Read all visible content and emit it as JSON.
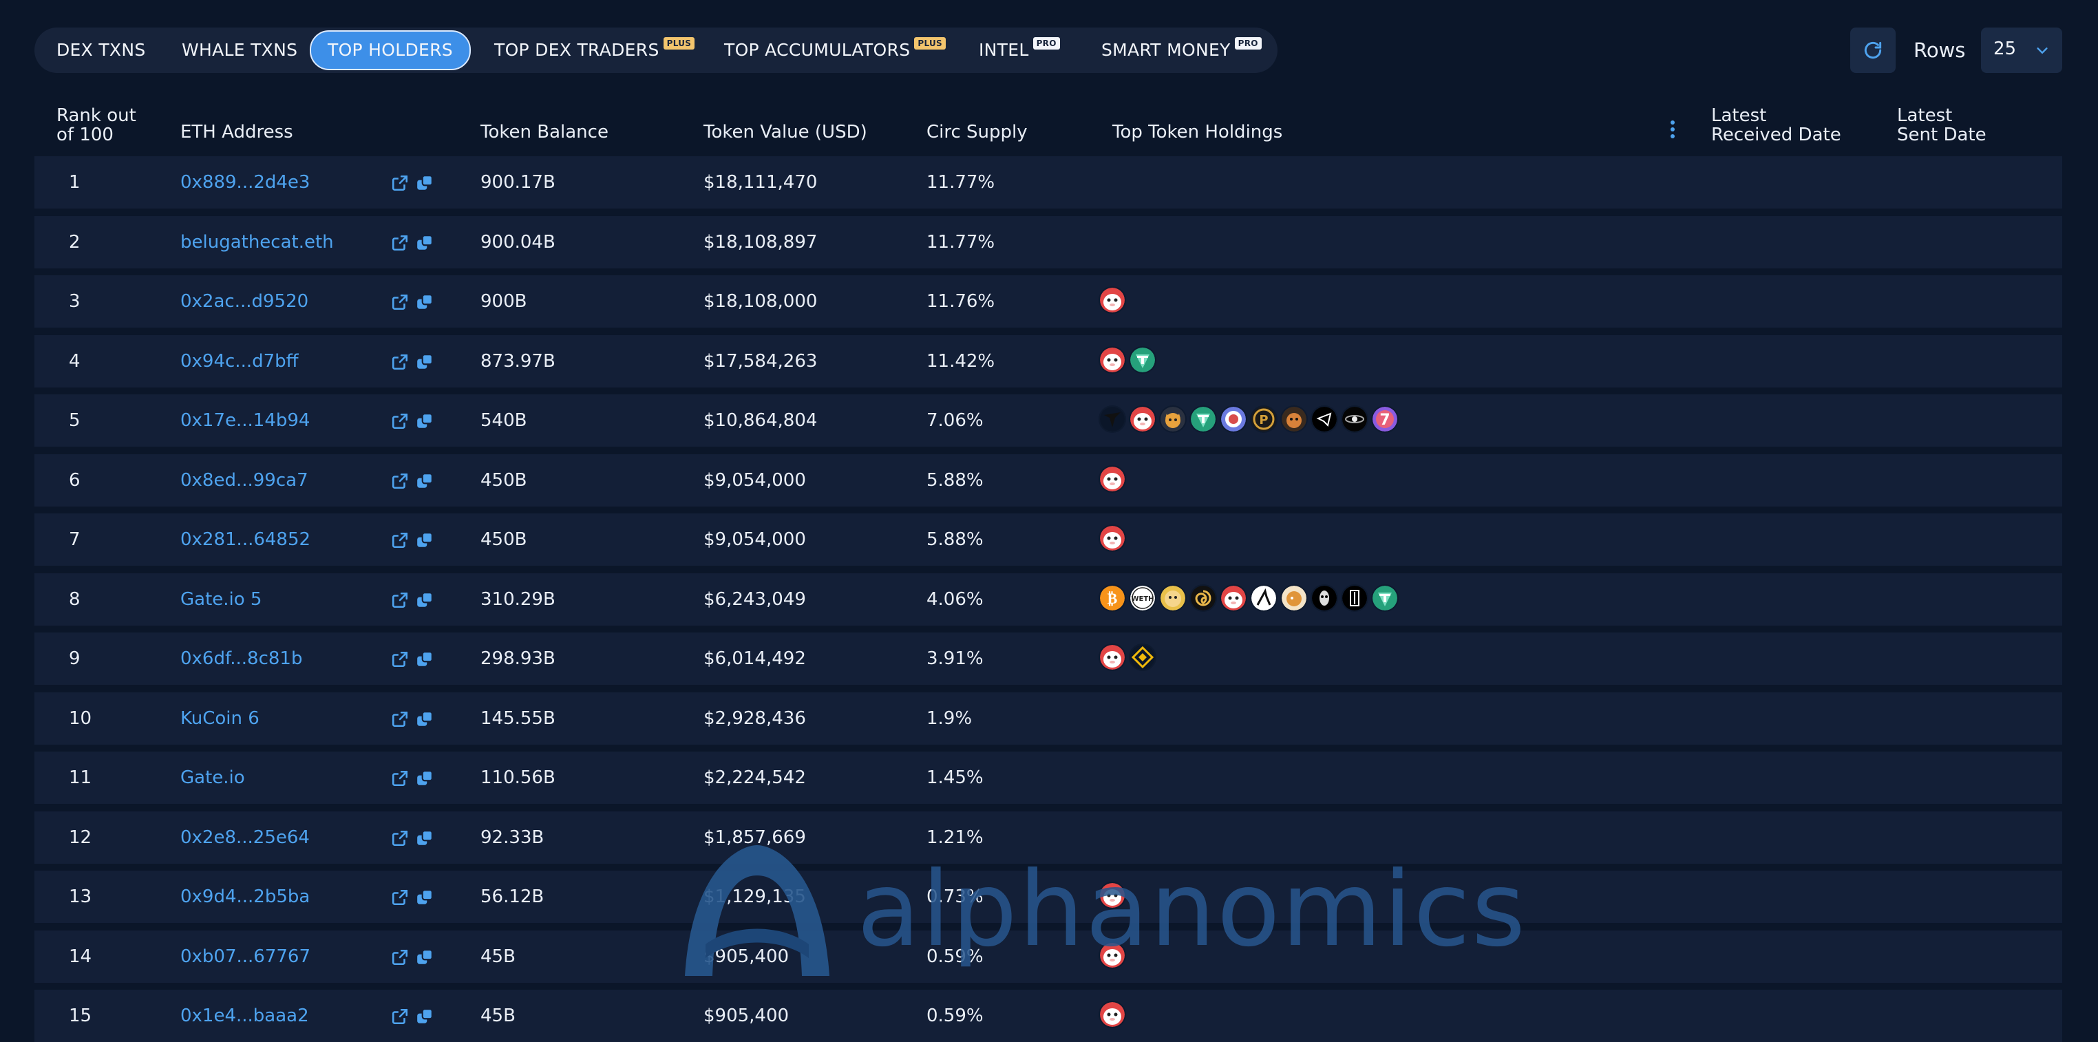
{
  "tabs": [
    {
      "label": "DEX TXNS",
      "badge": ""
    },
    {
      "label": "WHALE TXNS",
      "badge": ""
    },
    {
      "label": "TOP HOLDERS",
      "badge": ""
    },
    {
      "label": "TOP DEX TRADERS",
      "badge": "PLUS"
    },
    {
      "label": "TOP ACCUMULATORS",
      "badge": "PLUS"
    },
    {
      "label": "INTEL",
      "badge": "PRO"
    },
    {
      "label": "SMART MONEY",
      "badge": "PRO"
    }
  ],
  "active_tab": "TOP HOLDERS",
  "controls": {
    "rows_label": "Rows",
    "rows_value": "25"
  },
  "columns": {
    "rank": [
      "Rank out",
      "of 100"
    ],
    "address": "ETH Address",
    "balance": "Token Balance",
    "value": "Token Value (USD)",
    "supply": "Circ Supply",
    "holdings": "Top Token Holdings",
    "received": [
      "Latest",
      "Received Date"
    ],
    "sent": [
      "Latest",
      "Sent Date"
    ]
  },
  "rows": [
    {
      "rank": "1",
      "address": "0x889...2d4e3",
      "balance": "900.17B",
      "value": "$18,111,470",
      "supply": "11.77%",
      "holdings": []
    },
    {
      "rank": "2",
      "address": "belugathecat.eth",
      "balance": "900.04B",
      "value": "$18,108,897",
      "supply": "11.77%",
      "holdings": []
    },
    {
      "rank": "3",
      "address": "0x2ac...d9520",
      "balance": "900B",
      "value": "$18,108,000",
      "supply": "11.76%",
      "holdings": [
        "beluga"
      ]
    },
    {
      "rank": "4",
      "address": "0x94c...d7bff",
      "balance": "873.97B",
      "value": "$17,584,263",
      "supply": "11.42%",
      "holdings": [
        "beluga",
        "tether"
      ]
    },
    {
      "rank": "5",
      "address": "0x17e...14b94",
      "balance": "540B",
      "value": "$10,864,804",
      "supply": "7.06%",
      "holdings": [
        "dark",
        "beluga",
        "shiba",
        "tether",
        "bird",
        "pcoin",
        "dog",
        "telegram",
        "orb",
        "seven"
      ]
    },
    {
      "rank": "6",
      "address": "0x8ed...99ca7",
      "balance": "450B",
      "value": "$9,054,000",
      "supply": "5.88%",
      "holdings": [
        "beluga"
      ]
    },
    {
      "rank": "7",
      "address": "0x281...64852",
      "balance": "450B",
      "value": "$9,054,000",
      "supply": "5.88%",
      "holdings": [
        "beluga"
      ]
    },
    {
      "rank": "8",
      "address": "Gate.io 5",
      "balance": "310.29B",
      "value": "$6,243,049",
      "supply": "4.06%",
      "holdings": [
        "bitcoin",
        "weth",
        "doge",
        "spiral",
        "beluga",
        "arrow",
        "floki",
        "mask",
        "pillar",
        "tether"
      ]
    },
    {
      "rank": "9",
      "address": "0x6df...8c81b",
      "balance": "298.93B",
      "value": "$6,014,492",
      "supply": "3.91%",
      "holdings": [
        "beluga",
        "bnb"
      ]
    },
    {
      "rank": "10",
      "address": "KuCoin 6",
      "balance": "145.55B",
      "value": "$2,928,436",
      "supply": "1.9%",
      "holdings": []
    },
    {
      "rank": "11",
      "address": "Gate.io",
      "balance": "110.56B",
      "value": "$2,224,542",
      "supply": "1.45%",
      "holdings": []
    },
    {
      "rank": "12",
      "address": "0x2e8...25e64",
      "balance": "92.33B",
      "value": "$1,857,669",
      "supply": "1.21%",
      "holdings": []
    },
    {
      "rank": "13",
      "address": "0x9d4...2b5ba",
      "balance": "56.12B",
      "value": "$1,129,135",
      "supply": "0.73%",
      "holdings": [
        "beluga"
      ]
    },
    {
      "rank": "14",
      "address": "0xb07...67767",
      "balance": "45B",
      "value": "$905,400",
      "supply": "0.59%",
      "holdings": [
        "beluga"
      ]
    },
    {
      "rank": "15",
      "address": "0x1e4...baaa2",
      "balance": "45B",
      "value": "$905,400",
      "supply": "0.59%",
      "holdings": [
        "beluga"
      ]
    }
  ],
  "watermark": "alphanomics",
  "colors": {
    "background": "#0b1629",
    "row": "#131f37",
    "accent": "#3d8fe8",
    "link": "#4ea3ef"
  }
}
